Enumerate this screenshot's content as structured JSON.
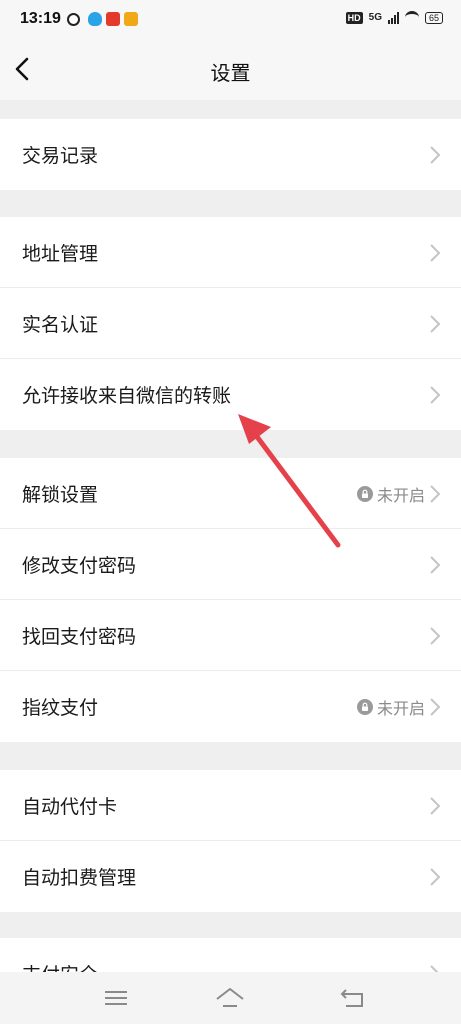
{
  "status_bar": {
    "time": "13:19",
    "network": "5G",
    "hd_badge": "HD",
    "battery": "65"
  },
  "header": {
    "title": "设置"
  },
  "groups": [
    {
      "items": [
        {
          "label": "交易记录"
        }
      ]
    },
    {
      "items": [
        {
          "label": "地址管理"
        },
        {
          "label": "实名认证"
        },
        {
          "label": "允许接收来自微信的转账"
        }
      ]
    },
    {
      "items": [
        {
          "label": "解锁设置",
          "status": "未开启"
        },
        {
          "label": "修改支付密码"
        },
        {
          "label": "找回支付密码"
        },
        {
          "label": "指纹支付",
          "status": "未开启"
        }
      ]
    },
    {
      "items": [
        {
          "label": "自动代付卡"
        },
        {
          "label": "自动扣费管理"
        }
      ]
    },
    {
      "items": [
        {
          "label": "支付安全"
        }
      ]
    }
  ],
  "colors": {
    "annotation_arrow": "#e5414a",
    "background": "#efefef",
    "row_background": "#ffffff"
  },
  "icons": {
    "back": "chevron-left-icon",
    "row_chevron": "chevron-right-icon",
    "status_lock": "lock-icon",
    "nav": [
      "menu-icon",
      "home-icon",
      "back-icon"
    ]
  }
}
